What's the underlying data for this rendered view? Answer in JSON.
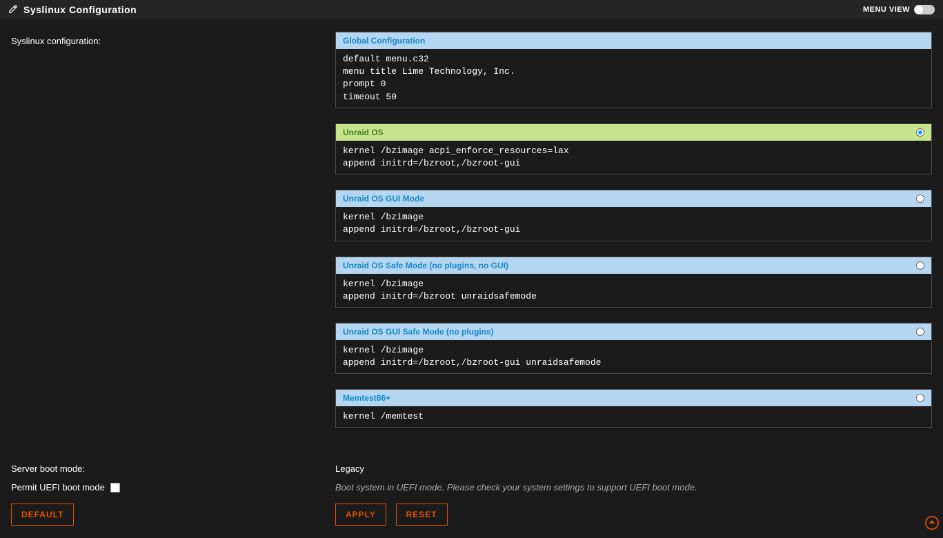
{
  "header": {
    "title": "Syslinux Configuration",
    "menu_view_label": "MENU VIEW"
  },
  "left": {
    "config_label": "Syslinux configuration:",
    "boot_mode_label": "Server boot mode:",
    "uefi_label": "Permit UEFI boot mode"
  },
  "boot_mode_value": "Legacy",
  "uefi_hint": "Boot system in UEFI mode. Please check your system settings to support UEFI boot mode.",
  "uefi_checked": false,
  "selected_entry": 1,
  "entries": [
    {
      "title": "Global Configuration",
      "body": "default menu.c32\nmenu title Lime Technology, Inc.\nprompt 0\ntimeout 50",
      "radio": false
    },
    {
      "title": "Unraid OS",
      "body": "kernel /bzimage acpi_enforce_resources=lax\nappend initrd=/bzroot,/bzroot-gui",
      "radio": true
    },
    {
      "title": "Unraid OS GUI Mode",
      "body": "kernel /bzimage\nappend initrd=/bzroot,/bzroot-gui",
      "radio": true
    },
    {
      "title": "Unraid OS Safe Mode (no plugins, no GUI)",
      "body": "kernel /bzimage\nappend initrd=/bzroot unraidsafemode",
      "radio": true
    },
    {
      "title": "Unraid OS GUI Safe Mode (no plugins)",
      "body": "kernel /bzimage\nappend initrd=/bzroot,/bzroot-gui unraidsafemode",
      "radio": true
    },
    {
      "title": "Memtest86+",
      "body": "kernel /memtest",
      "radio": true
    }
  ],
  "buttons": {
    "default": "DEFAULT",
    "apply": "APPLY",
    "reset": "RESET"
  }
}
